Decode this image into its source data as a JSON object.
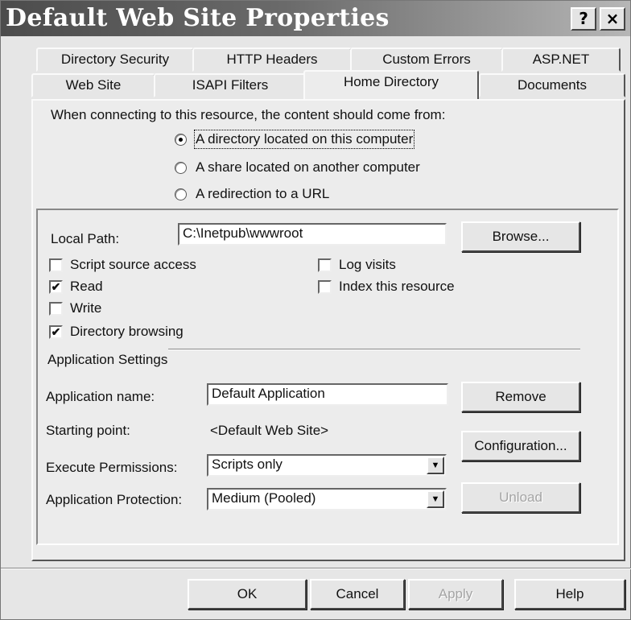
{
  "window": {
    "title": "Default Web Site Properties",
    "help_label": "?",
    "close_label": "×"
  },
  "tabs": {
    "back_row": [
      "Directory Security",
      "HTTP Headers",
      "Custom Errors",
      "ASP.NET"
    ],
    "front_row": [
      "Web Site",
      "ISAPI Filters",
      "Home Directory",
      "Documents"
    ],
    "selected": "Home Directory"
  },
  "content_source": {
    "prompt": "When connecting to this resource, the content should come from:",
    "options": [
      {
        "label": "A directory located on this computer",
        "selected": true
      },
      {
        "label": "A share located on another computer",
        "selected": false
      },
      {
        "label": "A redirection to a URL",
        "selected": false
      }
    ]
  },
  "local_path": {
    "label": "Local Path:",
    "value": "C:\\Inetpub\\wwwroot",
    "browse_label": "Browse..."
  },
  "permissions": {
    "left": [
      {
        "label": "Script source access",
        "checked": false
      },
      {
        "label": "Read",
        "checked": true
      },
      {
        "label": "Write",
        "checked": false
      },
      {
        "label": "Directory browsing",
        "checked": true
      }
    ],
    "right": [
      {
        "label": "Log visits",
        "checked": false
      },
      {
        "label": "Index this resource",
        "checked": false
      }
    ]
  },
  "application": {
    "section_label": "Application Settings",
    "name_label": "Application name:",
    "name_value": "Default Application",
    "remove_label": "Remove",
    "start_label": "Starting point:",
    "start_value": "<Default Web Site>",
    "config_label": "Configuration...",
    "exec_label": "Execute Permissions:",
    "exec_value": "Scripts only",
    "protect_label": "Application Protection:",
    "protect_value": "Medium (Pooled)",
    "unload_label": "Unload"
  },
  "footer": {
    "ok": "OK",
    "cancel": "Cancel",
    "apply": "Apply",
    "help": "Help"
  },
  "icons": {
    "dropdown": "▼",
    "check": "✔"
  }
}
